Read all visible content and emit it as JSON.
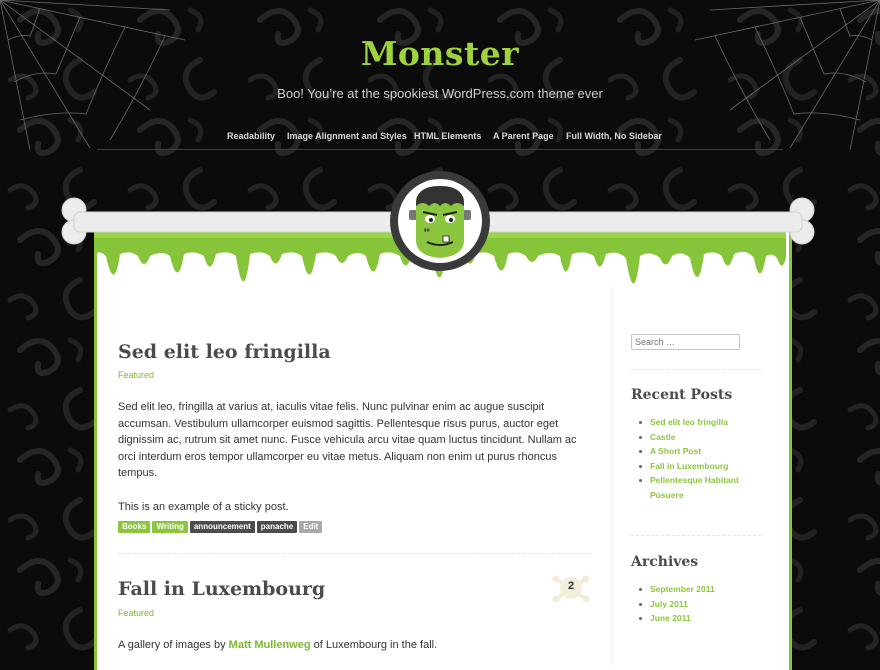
{
  "site": {
    "title": "Monster",
    "description": "Boo! You’re at the spookiest WordPress.com theme ever"
  },
  "nav": {
    "items": [
      {
        "label": "Readability"
      },
      {
        "label": "Image Alignment and Styles"
      },
      {
        "label": "HTML Elements"
      },
      {
        "label": "A Parent Page"
      },
      {
        "label": "Full Width, No Sidebar"
      }
    ]
  },
  "colors": {
    "accent": "#8cc63e",
    "slime": "#86c43a",
    "background": "#0b0b0b",
    "heading": "#4b4b4b"
  },
  "icons": {
    "logo": "frankenstein-monster-icon",
    "bone": "bone-icon",
    "comments": "skull-crossbones-icon",
    "webs": "spiderweb-icon"
  },
  "posts": [
    {
      "title": "Sed elit leo fringilla",
      "category": "Featured",
      "paragraph1": "Sed elit leo, fringilla at varius at, iaculis vitae felis. Nunc pulvinar enim ac augue suscipit accumsan. Vestibulum ullamcorper euismod sagittis. Pellentesque risus purus, auctor eget dignissim ac, rutrum sit amet nunc. Fusce vehicula arcu vitae quam luctus tincidunt. Nullam ac orci interdum eros tempor ullamcorper eu vitae metus. Aliquam non enim ut purus rhoncus tempus.",
      "paragraph2": "This is an example of a sticky post.",
      "tags": [
        "Books",
        "Writing",
        "announcement",
        "panache"
      ],
      "edit_label": "Edit"
    },
    {
      "title": "Fall in Luxembourg",
      "category": "Featured",
      "comment_count": "2",
      "excerpt_before": "A gallery of images by ",
      "excerpt_link": "Matt Mullenweg",
      "excerpt_after": " of Luxembourg in the fall."
    }
  ],
  "sidebar": {
    "search": {
      "placeholder": "Search …"
    },
    "recent_posts": {
      "title": "Recent Posts",
      "items": [
        "Sed elit leo fringilla",
        "Castle",
        "A Short Post",
        "Fall in Luxembourg",
        "Pellentesque Habitant Posuere"
      ]
    },
    "archives": {
      "title": "Archives",
      "items": [
        "September 2011",
        "July 2011",
        "June 2011"
      ]
    }
  }
}
